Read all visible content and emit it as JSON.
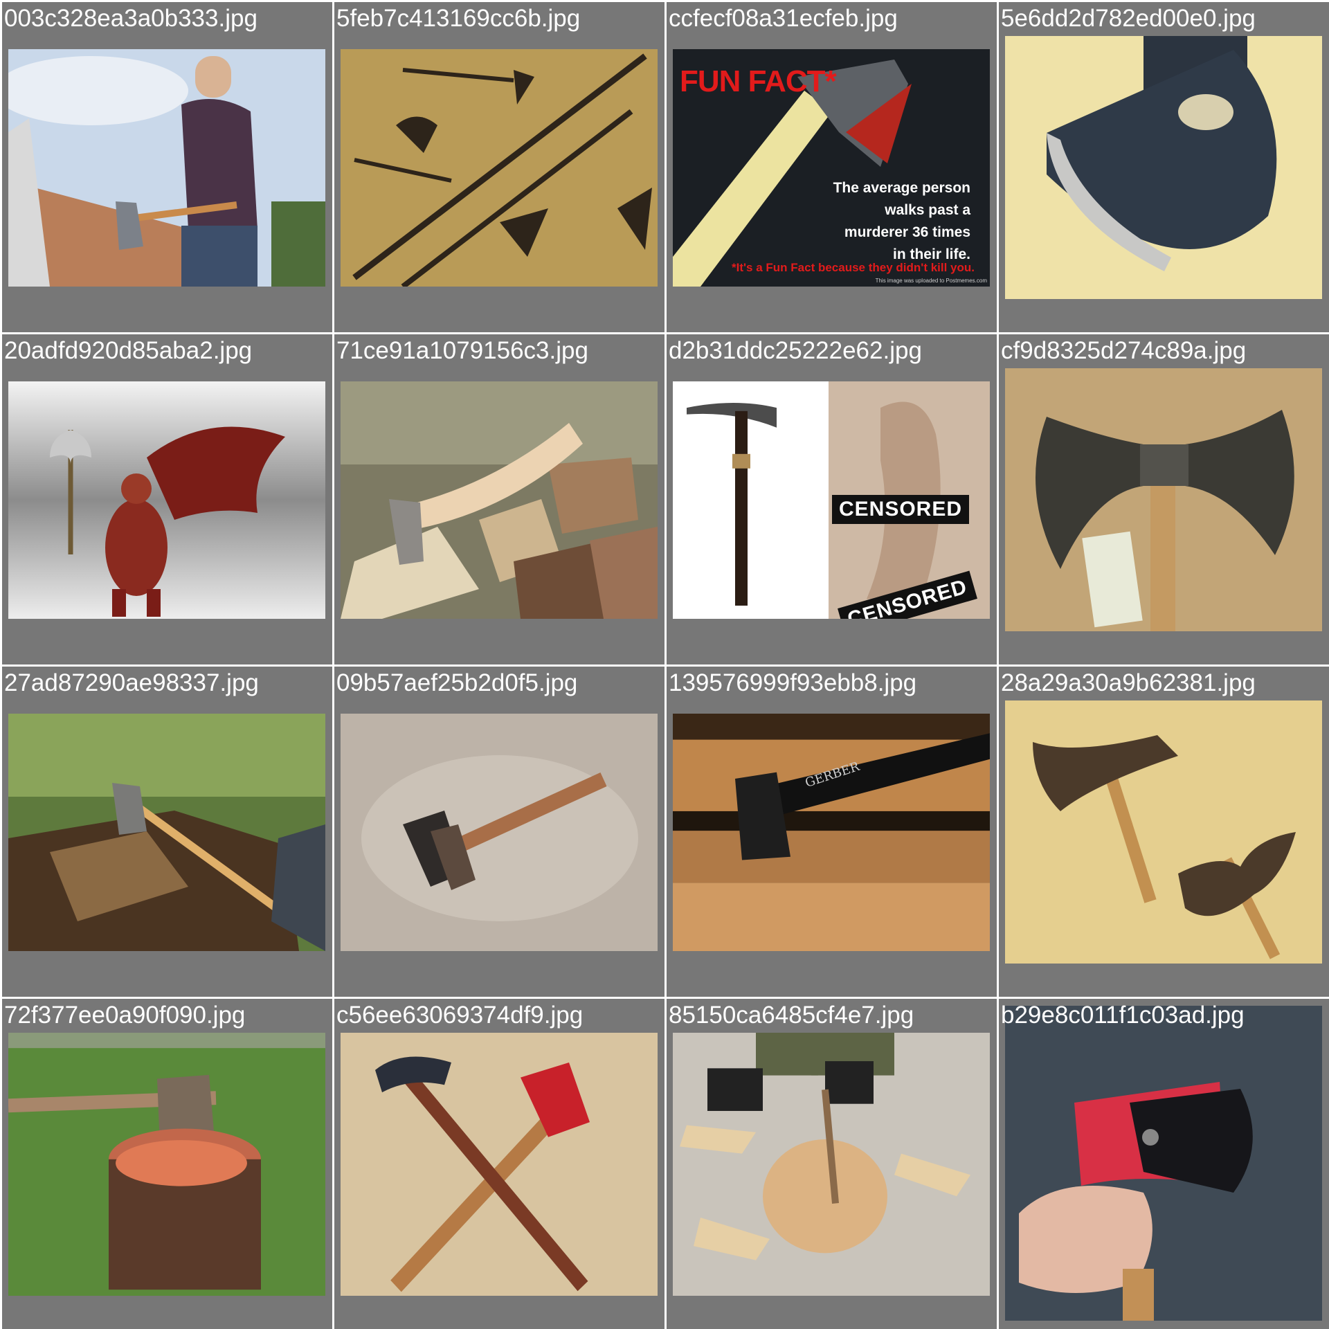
{
  "tiles": [
    {
      "label": "003c328ea3a0b333.jpg",
      "subject": "woman-axing-log"
    },
    {
      "label": "5feb7c413169cc6b.jpg",
      "subject": "pole-weapons"
    },
    {
      "label": "ccfecf08a31ecfeb.jpg",
      "subject": "fun-fact-meme",
      "meme": {
        "title": "FUN FACT*",
        "body": "The average person walks past a murderer 36 times in their life.",
        "footnote": "*It's a Fun Fact because they didn't kill you.",
        "credit": "This image was uploaded to Postmemes.com"
      }
    },
    {
      "label": "5e6dd2d782ed00e0.jpg",
      "subject": "axe-head-closeup"
    },
    {
      "label": "20adfd920d85aba2.jpg",
      "subject": "demon-figurine"
    },
    {
      "label": "71ce91a1079156c3.jpg",
      "subject": "hatchet-in-woodpile"
    },
    {
      "label": "d2b31ddc25222e62.jpg",
      "subject": "tomahawk-and-censored-poster",
      "censor_text": "CENSORED"
    },
    {
      "label": "cf9d8325d274c89a.jpg",
      "subject": "double-axe-with-bill"
    },
    {
      "label": "27ad87290ae98337.jpg",
      "subject": "axe-in-log-outdoors"
    },
    {
      "label": "09b57aef25b2d0f5.jpg",
      "subject": "small-hatchet"
    },
    {
      "label": "139576999f93ebb8.jpg",
      "subject": "gerber-axe-on-logs",
      "brand_text": "GERBER"
    },
    {
      "label": "28a29a30a9b62381.jpg",
      "subject": "two-antique-axes"
    },
    {
      "label": "72f377ee0a90f090.jpg",
      "subject": "axe-in-stump-grass"
    },
    {
      "label": "c56ee63069374df9.jpg",
      "subject": "hammer-and-red-hatchet"
    },
    {
      "label": "85150ca6485cf4e7.jpg",
      "subject": "splitting-wood"
    },
    {
      "label": "b29e8c011f1c03ad.jpg",
      "subject": "hand-holding-red-hatchet"
    }
  ],
  "colors": {
    "tile_bg": "#777777",
    "label_text": "#ffffff",
    "meme_red": "#e21b1b"
  }
}
